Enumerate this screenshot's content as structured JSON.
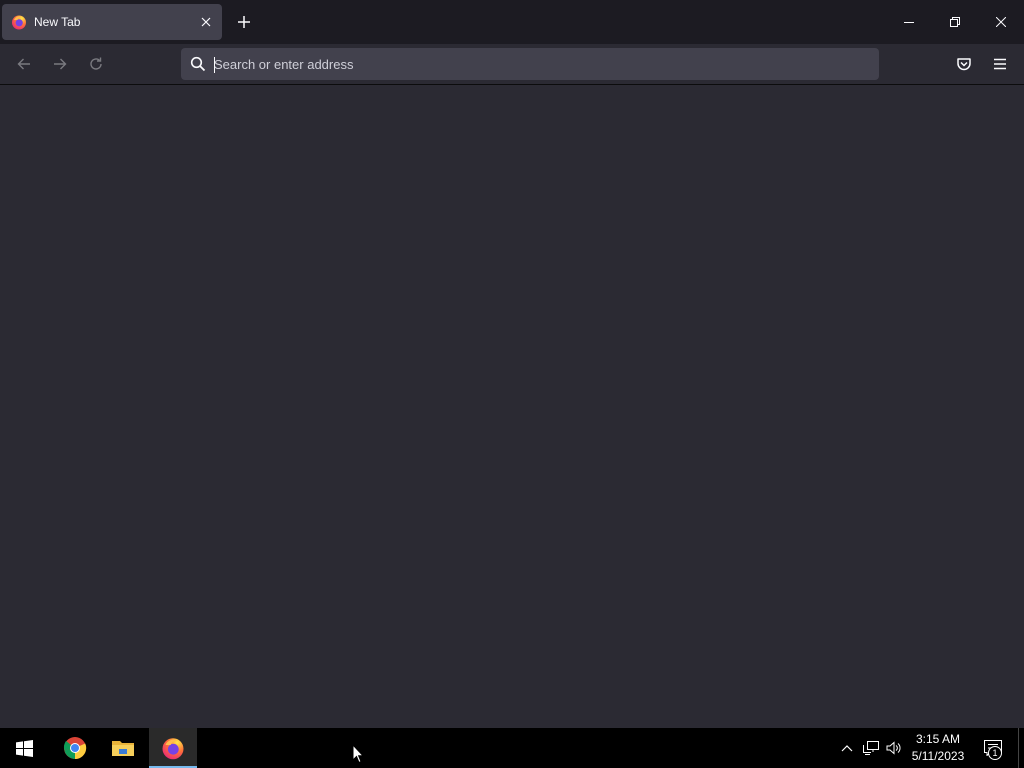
{
  "browser": {
    "tab": {
      "title": "New Tab",
      "favicon": "firefox-icon",
      "close_icon": "close-icon"
    },
    "new_tab_icon": "plus-icon",
    "window_controls": {
      "minimize": "minimize-icon",
      "restore": "restore-icon",
      "close": "close-icon"
    },
    "navigation": {
      "back": "back-arrow-icon",
      "forward": "forward-arrow-icon",
      "reload": "reload-icon"
    },
    "urlbar": {
      "placeholder": "Search or enter address",
      "value": "",
      "icon": "search-icon"
    },
    "toolbar": {
      "pocket": "pocket-icon",
      "menu": "hamburger-menu-icon"
    },
    "colors": {
      "tabstrip": "#1c1b22",
      "toolbar": "#2b2a33",
      "urlbar": "#42414d",
      "active_tab": "#42414d",
      "content": "#2b2a33"
    }
  },
  "taskbar": {
    "apps": [
      {
        "name": "Start",
        "icon": "windows-start-icon"
      },
      {
        "name": "Google Chrome",
        "icon": "chrome-icon"
      },
      {
        "name": "File Explorer",
        "icon": "folder-icon"
      },
      {
        "name": "Firefox",
        "icon": "firefox-icon",
        "active": true
      }
    ],
    "tray": {
      "chevron": "chevron-up-icon",
      "network": "network-icon",
      "volume": "volume-icon"
    },
    "clock": {
      "time": "3:15 AM",
      "date": "5/11/2023"
    },
    "notifications": {
      "icon": "action-center-icon",
      "count": "1"
    }
  }
}
